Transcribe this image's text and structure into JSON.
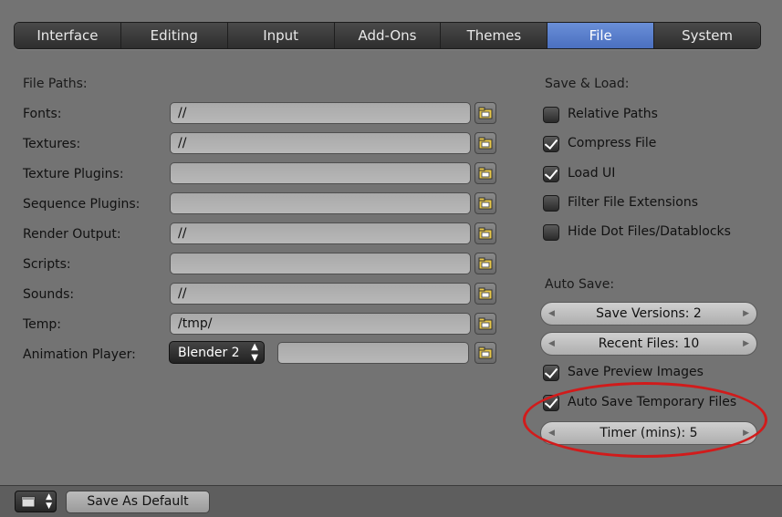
{
  "tabs": [
    "Interface",
    "Editing",
    "Input",
    "Add-Ons",
    "Themes",
    "File",
    "System"
  ],
  "active_tab": "File",
  "file_paths": {
    "title": "File Paths:",
    "rows": [
      {
        "label": "Fonts:",
        "value": "//"
      },
      {
        "label": "Textures:",
        "value": "//"
      },
      {
        "label": "Texture Plugins:",
        "value": ""
      },
      {
        "label": "Sequence Plugins:",
        "value": ""
      },
      {
        "label": "Render Output:",
        "value": "//"
      },
      {
        "label": "Scripts:",
        "value": ""
      },
      {
        "label": "Sounds:",
        "value": "//"
      },
      {
        "label": "Temp:",
        "value": "/tmp/"
      }
    ],
    "animation_player": {
      "label": "Animation Player:",
      "select": "Blender 2",
      "value": ""
    }
  },
  "save_load": {
    "title": "Save & Load:",
    "options": [
      {
        "label": "Relative Paths",
        "checked": false
      },
      {
        "label": "Compress File",
        "checked": true
      },
      {
        "label": "Load UI",
        "checked": true
      },
      {
        "label": "Filter File Extensions",
        "checked": false
      },
      {
        "label": "Hide Dot Files/Datablocks",
        "checked": false
      }
    ]
  },
  "auto_save": {
    "title": "Auto Save:",
    "save_versions": "Save Versions: 2",
    "recent_files": "Recent Files: 10",
    "save_preview_images": {
      "label": "Save Preview Images",
      "checked": true
    },
    "auto_save_temp": {
      "label": "Auto Save Temporary Files",
      "checked": true
    },
    "timer": "Timer (mins): 5"
  },
  "bottom": {
    "save_default": "Save As Default"
  },
  "colors": {
    "active_tab": "#5a7fcf",
    "highlight": "#d11b1b"
  },
  "icons": [
    "folder-icon",
    "editor-type-icon",
    "up-down-arrows-icon"
  ]
}
